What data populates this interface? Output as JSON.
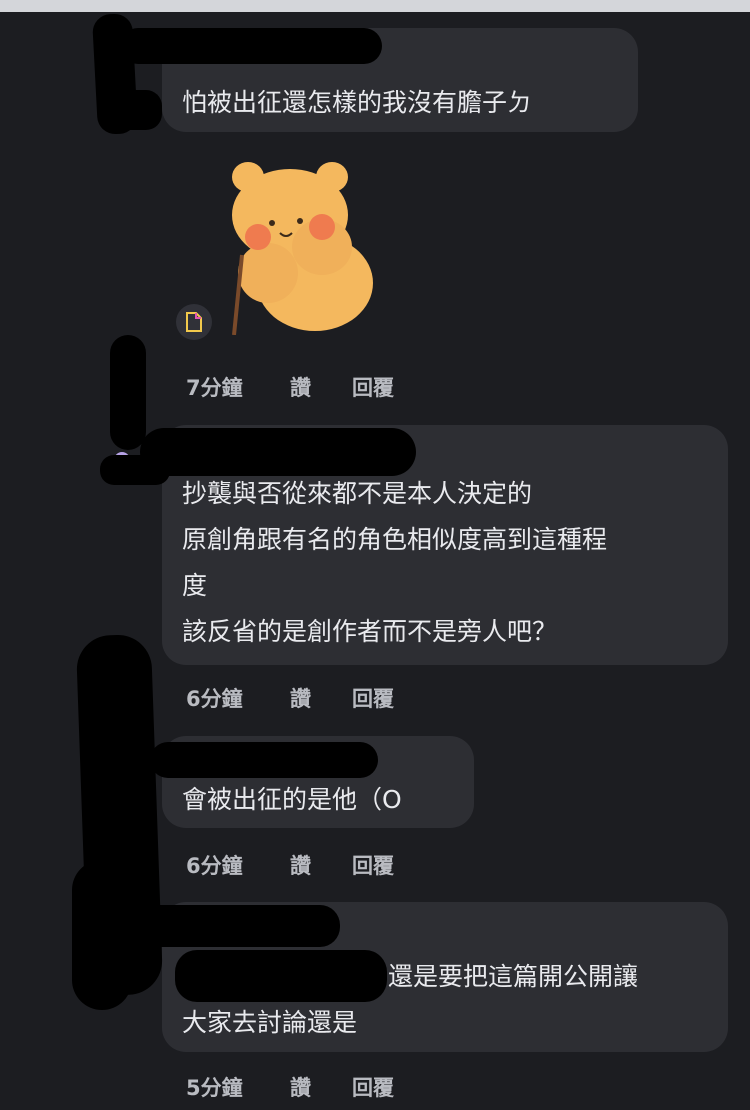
{
  "comments": [
    {
      "lines": [
        "怕被出征還怎樣的我沒有膽子ㄉ"
      ],
      "time": "7分鐘",
      "like": "讚",
      "reply": "回覆",
      "status_color": "#f05a66",
      "sticker": "bear-sticker"
    },
    {
      "lines": [
        "抄襲與否從來都不是本人決定的",
        "原創角跟有名的角色相似度高到這種程",
        "度",
        "該反省的是創作者而不是旁人吧？"
      ],
      "time": "6分鐘",
      "like": "讚",
      "reply": "回覆",
      "status_color": "#b7a3e6"
    },
    {
      "lines": [
        "會被出征的是他（O"
      ],
      "time": "6分鐘",
      "like": "讚",
      "reply": "回覆",
      "status_color": "#b7a3e6"
    },
    {
      "lines": [
        "還是要把這篇開公開讓",
        "大家去討論還是"
      ],
      "time": "5分鐘",
      "like": "讚",
      "reply": "回覆",
      "status_color": "#f05a66"
    }
  ],
  "colors": {
    "background": "#1c1d21",
    "bubble": "#2d2e33",
    "text": "#e9eaee",
    "action_text": "#b9bbc1"
  }
}
